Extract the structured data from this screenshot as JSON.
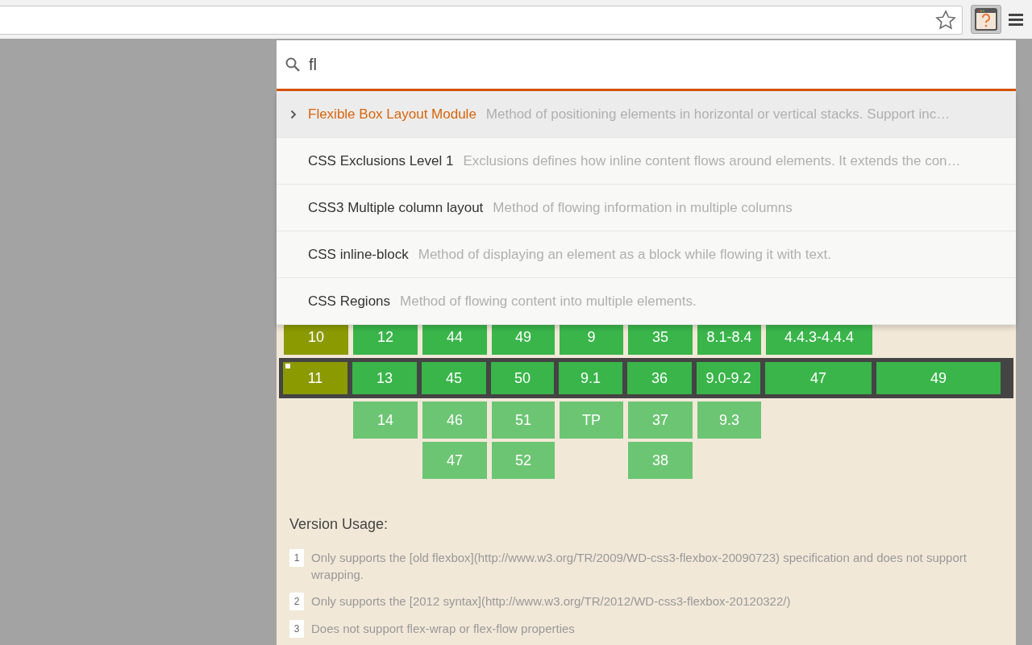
{
  "search": {
    "value": "fl"
  },
  "suggestions": [
    {
      "title": "Flexible Box Layout Module",
      "description": "Method of positioning elements in horizontal or vertical stacks. Support inc…",
      "selected": true
    },
    {
      "title": "CSS Exclusions Level 1",
      "description": "Exclusions defines how inline content flows around elements. It extends the con…",
      "selected": false
    },
    {
      "title": "CSS3 Multiple column layout",
      "description": "Method of flowing information in multiple columns",
      "selected": false
    },
    {
      "title": "CSS inline-block",
      "description": "Method of displaying an element as a block while flowing it with text.",
      "selected": false
    },
    {
      "title": "CSS Regions",
      "description": "Method of flowing content into multiple elements.",
      "selected": false
    }
  ],
  "version_rows": [
    {
      "kind": "past",
      "cells": [
        {
          "text": "10",
          "kind": "partial"
        },
        {
          "text": "12",
          "kind": "full"
        },
        {
          "text": "44",
          "kind": "full"
        },
        {
          "text": "49",
          "kind": "full"
        },
        {
          "text": "9",
          "kind": "full"
        },
        {
          "text": "35",
          "kind": "full"
        },
        {
          "text": "8.1-8.4",
          "kind": "full"
        },
        {
          "text": "4.4.3-4.4.4",
          "kind": "full"
        },
        null
      ]
    },
    {
      "kind": "current",
      "cells": [
        {
          "text": "11",
          "kind": "partial",
          "note_mark": true
        },
        {
          "text": "13",
          "kind": "full"
        },
        {
          "text": "45",
          "kind": "full"
        },
        {
          "text": "50",
          "kind": "full"
        },
        {
          "text": "9.1",
          "kind": "full"
        },
        {
          "text": "36",
          "kind": "full"
        },
        {
          "text": "9.0-9.2",
          "kind": "full"
        },
        {
          "text": "47",
          "kind": "full"
        },
        {
          "text": "49",
          "kind": "full"
        }
      ]
    },
    {
      "kind": "future",
      "cells": [
        null,
        {
          "text": "14",
          "kind": "full"
        },
        {
          "text": "46",
          "kind": "full"
        },
        {
          "text": "51",
          "kind": "full"
        },
        {
          "text": "TP",
          "kind": "full"
        },
        {
          "text": "37",
          "kind": "full"
        },
        {
          "text": "9.3",
          "kind": "full"
        },
        null,
        null
      ]
    },
    {
      "kind": "future",
      "cells": [
        null,
        null,
        {
          "text": "47",
          "kind": "full"
        },
        {
          "text": "52",
          "kind": "full"
        },
        null,
        {
          "text": "38",
          "kind": "full"
        },
        null,
        null,
        null
      ]
    }
  ],
  "notes": {
    "heading": "Version Usage:",
    "items": [
      {
        "number": "1",
        "text": "Only supports the [old flexbox](http://www.w3.org/TR/2009/WD-css3-flexbox-20090723) specification and does not support wrapping."
      },
      {
        "number": "2",
        "text": "Only supports the [2012 syntax](http://www.w3.org/TR/2012/WD-css3-flexbox-20120322/)"
      },
      {
        "number": "3",
        "text": "Does not support flex-wrap or flex-flow properties"
      }
    ]
  }
}
